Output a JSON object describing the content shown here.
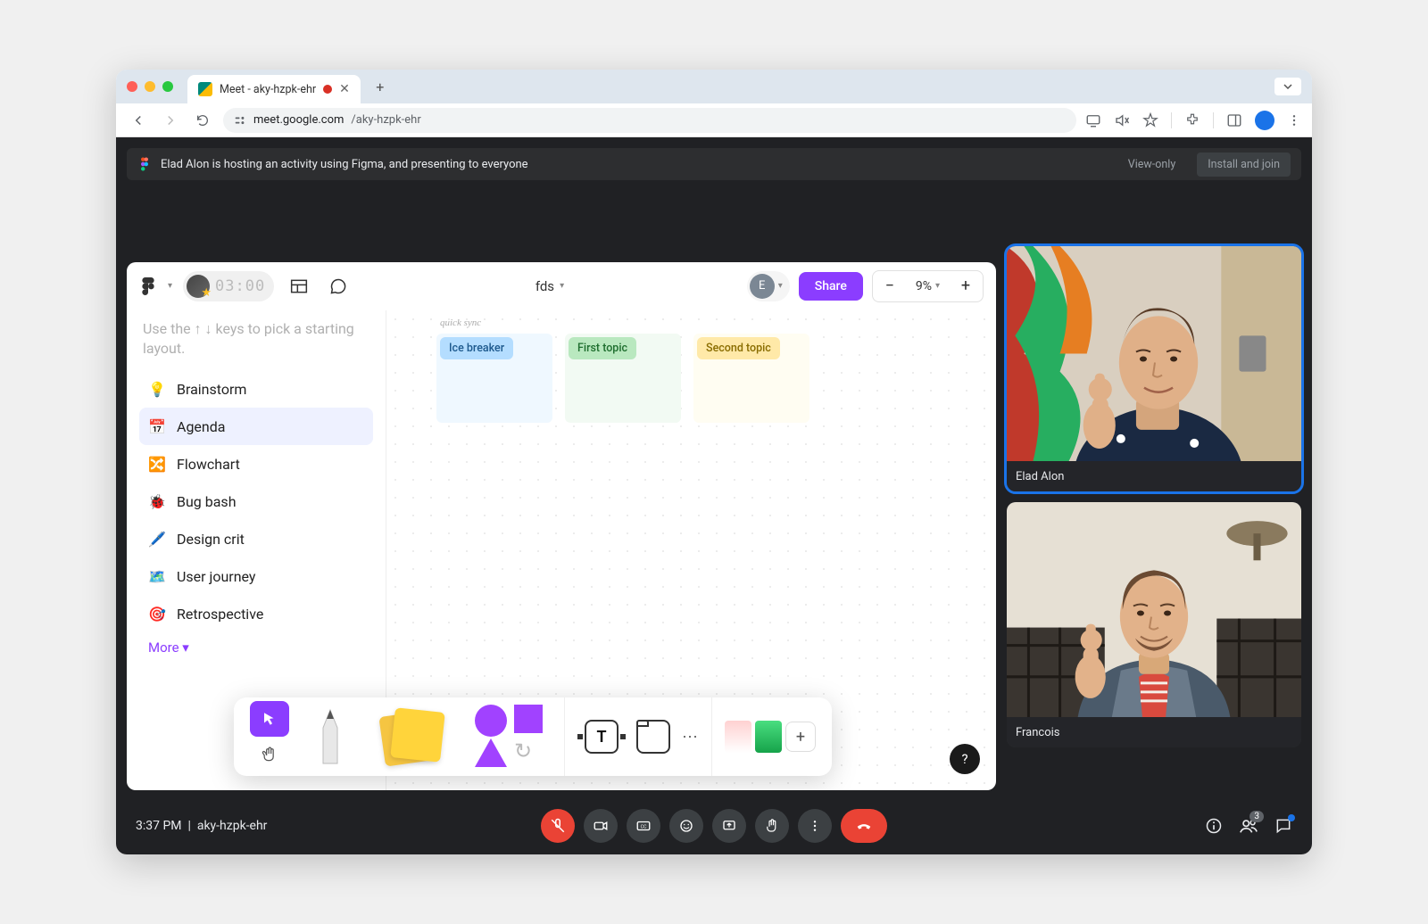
{
  "browser": {
    "tab_title": "Meet - aky-hzpk-ehr",
    "url_host": "meet.google.com",
    "url_path": "/aky-hzpk-ehr"
  },
  "banner": {
    "text": "Elad Alon is hosting an activity using Figma, and presenting to everyone",
    "view_only": "View-only",
    "install": "Install and join"
  },
  "figma": {
    "timer": "03:00",
    "doc_title": "fds",
    "avatar_initial": "E",
    "share": "Share",
    "zoom": "9%",
    "hint": "Use the ↑ ↓ keys to pick a starting layout.",
    "templates": [
      {
        "label": "Brainstorm",
        "icon": "💡",
        "color": "#f5b748"
      },
      {
        "label": "Agenda",
        "icon": "📅",
        "color": "#4f7eff"
      },
      {
        "label": "Flowchart",
        "icon": "🔀",
        "color": "#34a853"
      },
      {
        "label": "Bug bash",
        "icon": "🐞",
        "color": "#ea4335"
      },
      {
        "label": "Design crit",
        "icon": "🖊️",
        "color": "#8b3dff"
      },
      {
        "label": "User journey",
        "icon": "🗺️",
        "color": "#4f46e5"
      },
      {
        "label": "Retrospective",
        "icon": "🎯",
        "color": "#10b981"
      }
    ],
    "more": "More",
    "canvas_title": "quick sync",
    "cards": [
      {
        "label": "Ice breaker"
      },
      {
        "label": "First topic"
      },
      {
        "label": "Second topic"
      }
    ]
  },
  "participants": [
    {
      "name": "Elad Alon",
      "speaking": true,
      "muted": false
    },
    {
      "name": "Francois",
      "speaking": false,
      "muted": true
    }
  ],
  "footer": {
    "time": "3:37 PM",
    "code": "aky-hzpk-ehr",
    "people_count": "3"
  }
}
